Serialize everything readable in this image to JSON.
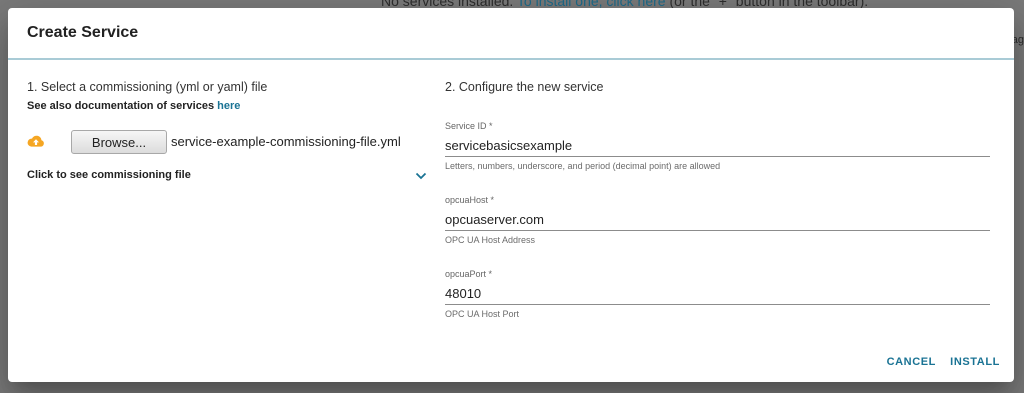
{
  "backdrop": {
    "line_before": "No services installed.",
    "line_link": "To install one, click here",
    "line_after": "(or the \"+\" button in the toolbar).",
    "edge_text": "ag"
  },
  "dialog": {
    "title": "Create Service",
    "left": {
      "heading": "1. Select a commissioning (yml or yaml) file",
      "doc_text": "See also documentation of services",
      "doc_link": "here",
      "upload_icon": "cloud-upload-icon",
      "browse_label": "Browse...",
      "file_name": "service-example-commissioning-file.yml",
      "expand_label": "Click to see commissioning file",
      "expand_icon": "chevron-down-icon"
    },
    "right": {
      "heading": "2. Configure the new service",
      "fields": [
        {
          "label": "Service ID *",
          "value": "servicebasicsexample",
          "help": "Letters, numbers, underscore, and period (decimal point) are allowed"
        },
        {
          "label": "opcuaHost *",
          "value": "opcuaserver.com",
          "help": "OPC UA Host Address"
        },
        {
          "label": "opcuaPort *",
          "value": "48010",
          "help": "OPC UA Host Port"
        }
      ]
    },
    "actions": {
      "cancel": "CANCEL",
      "install": "INSTALL"
    },
    "colors": {
      "accent": "#1a7394",
      "upload_icon": "#f5a623",
      "header_rule": "#a9cbd6"
    }
  }
}
